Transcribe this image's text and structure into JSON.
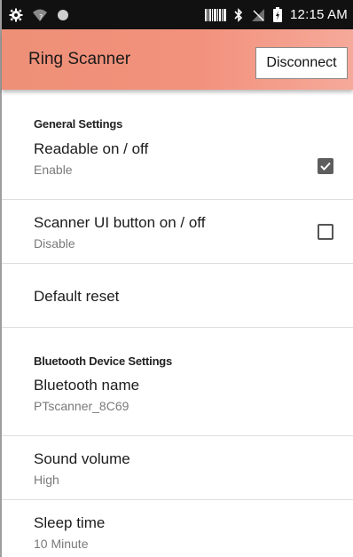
{
  "status_bar": {
    "time": "12:15 AM",
    "icons_left": [
      "gear-icon",
      "wifi-question-icon",
      "record-icon"
    ],
    "icons_right": [
      "barcode-icon",
      "bluetooth-icon",
      "no-signal-icon",
      "battery-charging-icon"
    ]
  },
  "app_bar": {
    "title": "Ring Scanner",
    "disconnect_label": "Disconnect",
    "accent_color": "#F2917C"
  },
  "general_settings": {
    "header": "General Settings",
    "items": [
      {
        "title": "Readable on / off",
        "subtitle": "Enable",
        "checked": true
      },
      {
        "title": "Scanner UI button on / off",
        "subtitle": "Disable",
        "checked": false
      },
      {
        "title": "Default reset"
      }
    ]
  },
  "bluetooth_settings": {
    "header": "Bluetooth Device Settings",
    "items": [
      {
        "title": "Bluetooth name",
        "subtitle": "PTscanner_8C69"
      },
      {
        "title": "Sound volume",
        "subtitle": "High"
      },
      {
        "title": "Sleep time",
        "subtitle": "10 Minute"
      }
    ]
  }
}
